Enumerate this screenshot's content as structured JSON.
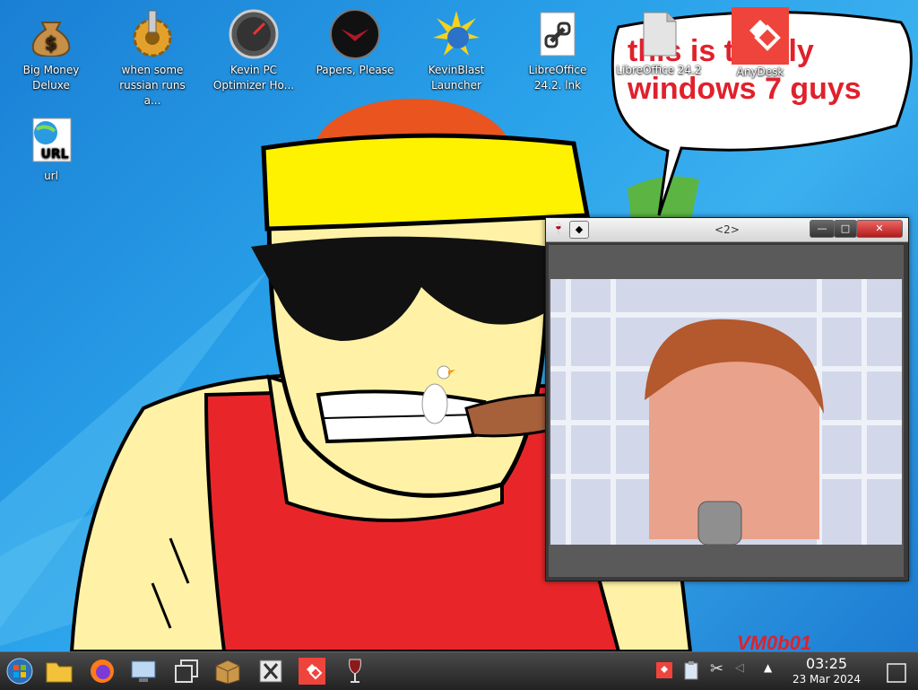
{
  "desktop": {
    "icons": [
      {
        "label": "Big Money Deluxe"
      },
      {
        "label": "when some russian runs a..."
      },
      {
        "label": "Kevin PC Optimizer Ho..."
      },
      {
        "label": "Papers, Please"
      },
      {
        "label": "KevinBlast Launcher"
      },
      {
        "label": "LibreOffice 24.2. lnk"
      },
      {
        "label": "LibreOffice 24.2"
      },
      {
        "label": "AnyDesk"
      },
      {
        "label": "url"
      }
    ],
    "speech_bubble": "this is totally windows 7 guys",
    "watermark": "VM0b01"
  },
  "window": {
    "title": "<2>",
    "minimize": "—",
    "maximize": "□",
    "close": "✕"
  },
  "taskbar": {
    "clock_time": "03:25",
    "clock_date": "23 Mar 2024"
  }
}
